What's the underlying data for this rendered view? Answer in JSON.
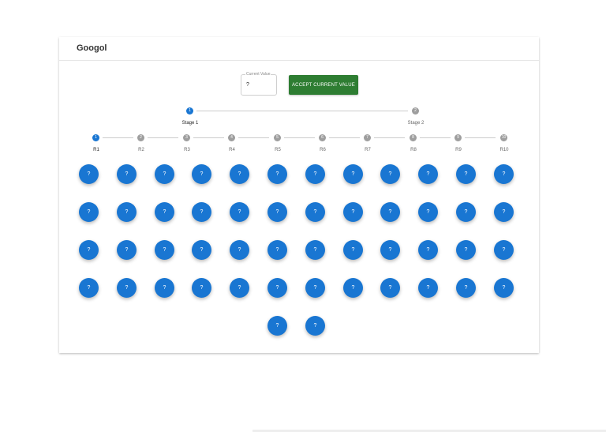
{
  "app": {
    "title": "Googol"
  },
  "current_value": {
    "label": "Current Value",
    "value": "?"
  },
  "accept_button": {
    "label": "ACCEPT CURRENT VALUE",
    "color": "#2e7d32"
  },
  "accent_color": "#1976d2",
  "stages": [
    {
      "number": "1",
      "label": "Stage 1",
      "active": true
    },
    {
      "number": "2",
      "label": "Stage 2",
      "active": false
    }
  ],
  "rounds": [
    {
      "number": "1",
      "label": "R1",
      "active": true
    },
    {
      "number": "2",
      "label": "R2",
      "active": false
    },
    {
      "number": "3",
      "label": "R3",
      "active": false
    },
    {
      "number": "4",
      "label": "R4",
      "active": false
    },
    {
      "number": "5",
      "label": "R5",
      "active": false
    },
    {
      "number": "6",
      "label": "R6",
      "active": false
    },
    {
      "number": "7",
      "label": "R7",
      "active": false
    },
    {
      "number": "8",
      "label": "R8",
      "active": false
    },
    {
      "number": "9",
      "label": "R9",
      "active": false
    },
    {
      "number": "10",
      "label": "R10",
      "active": false
    }
  ],
  "value_buttons": [
    [
      "?",
      "?",
      "?",
      "?",
      "?",
      "?",
      "?",
      "?",
      "?",
      "?",
      "?",
      "?"
    ],
    [
      "?",
      "?",
      "?",
      "?",
      "?",
      "?",
      "?",
      "?",
      "?",
      "?",
      "?",
      "?"
    ],
    [
      "?",
      "?",
      "?",
      "?",
      "?",
      "?",
      "?",
      "?",
      "?",
      "?",
      "?",
      "?"
    ],
    [
      "?",
      "?",
      "?",
      "?",
      "?",
      "?",
      "?",
      "?",
      "?",
      "?",
      "?",
      "?"
    ],
    [
      "?",
      "?"
    ]
  ]
}
